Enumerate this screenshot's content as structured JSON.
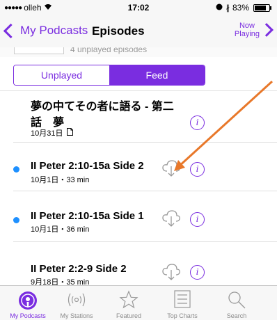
{
  "status": {
    "carrier": "olleh",
    "time": "17:02",
    "battery": "83%"
  },
  "nav": {
    "back_label": "My Podcasts",
    "title": "Episodes",
    "now_playing_line1": "Now",
    "now_playing_line2": "Playing"
  },
  "header": {
    "unplayed_count": "4 unplayed episodes"
  },
  "segments": {
    "unplayed": "Unplayed",
    "feed": "Feed",
    "selected": "Feed"
  },
  "episodes": [
    {
      "title_line1": "夢の中てその者に語る - 第二",
      "title_line2": "話　夢",
      "meta": "10月31日"
    },
    {
      "title": "II Peter 2:10-15a Side 2",
      "meta": "10月1日・33 min"
    },
    {
      "title": "II Peter 2:10-15a Side 1",
      "meta": "10月1日・36 min"
    },
    {
      "title": "II Peter 2:2-9 Side 2",
      "meta": "9月18日・35 min"
    }
  ],
  "tabs": [
    {
      "label": "My Podcasts",
      "icon": "podcast-icon"
    },
    {
      "label": "My Stations",
      "icon": "stations-icon"
    },
    {
      "label": "Featured",
      "icon": "star-icon"
    },
    {
      "label": "Top Charts",
      "icon": "list-icon"
    },
    {
      "label": "Search",
      "icon": "search-icon"
    }
  ],
  "colors": {
    "accent": "#7a2de0",
    "unplayed_dot": "#1e90ff",
    "annotation_arrow": "#e8782a"
  }
}
